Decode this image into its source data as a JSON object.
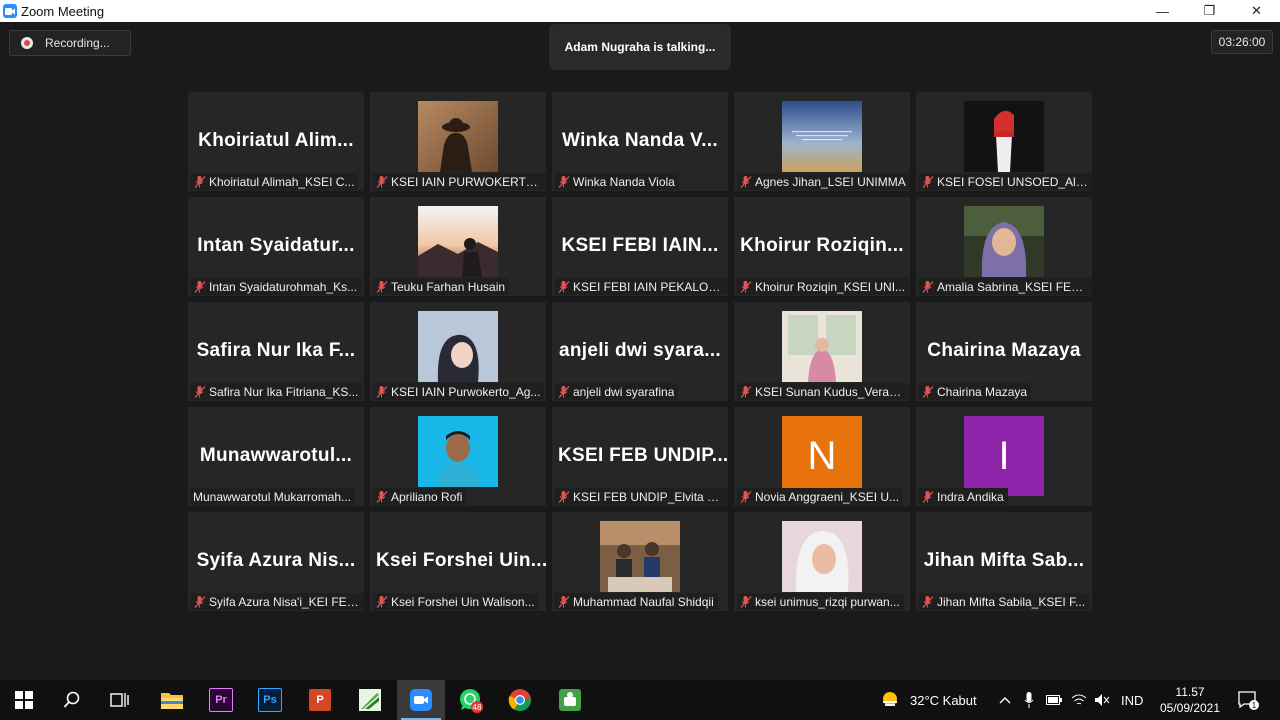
{
  "window": {
    "title": "Zoom Meeting",
    "minimize_glyph": "—",
    "restore_glyph": "❐",
    "close_glyph": "✕"
  },
  "meeting": {
    "recording_label": "Recording...",
    "talking_label": "Adam Nugraha is talking...",
    "timer": "03:26:00"
  },
  "participants": [
    {
      "display_text": "Khoiriatul Alim...",
      "name": "Khoiriatul Alimah_KSEI C...",
      "muted": true
    },
    {
      "display_text": "",
      "name": "KSEI IAIN PURWOKERTO_Silv...",
      "muted": true,
      "photo": "silhouette-hat"
    },
    {
      "display_text": "Winka Nanda V...",
      "name": "Winka Nanda Viola",
      "muted": true
    },
    {
      "display_text": "",
      "name": "Agnes Jihan_LSEI UNIMMA",
      "muted": true,
      "photo": "sky-quote"
    },
    {
      "display_text": "",
      "name": "KSEI FOSEI UNSOED_Alvi...",
      "muted": true,
      "photo": "fist-flag"
    },
    {
      "display_text": "Intan Syaidatur...",
      "name": "Intan Syaidaturohmah_Ks...",
      "muted": true
    },
    {
      "display_text": "",
      "name": "Teuku Farhan Husain",
      "muted": true,
      "photo": "mountain-sunset"
    },
    {
      "display_text": "KSEI FEBI IAIN...",
      "name": "KSEI FEBI IAIN PEKALONG...",
      "muted": true
    },
    {
      "display_text": "Khoirur Roziqin...",
      "name": "Khoirur Roziqin_KSEI UNI...",
      "muted": true
    },
    {
      "display_text": "",
      "name": "Amalia Sabrina_KSEI FEB ...",
      "muted": true,
      "photo": "hijab-smile"
    },
    {
      "display_text": "Safira Nur Ika F...",
      "name": "Safira Nur Ika Fitriana_KS...",
      "muted": true
    },
    {
      "display_text": "",
      "name": "KSEI IAIN Purwokerto_Ag...",
      "muted": true,
      "photo": "selfie-pastel"
    },
    {
      "display_text": "anjeli dwi syara...",
      "name": "anjeli dwi syarafina",
      "muted": true
    },
    {
      "display_text": "",
      "name": "KSEI Sunan Kudus_Veraw...",
      "muted": true,
      "photo": "window-seat"
    },
    {
      "display_text": "Chairina Mazaya",
      "name": "Chairina Mazaya",
      "muted": true
    },
    {
      "display_text": "Munawwarotul...",
      "name": "Munawwarotul Mukarromah...",
      "muted": false
    },
    {
      "display_text": "",
      "name": "Apriliano Rofi",
      "muted": true,
      "photo": "blue-portrait"
    },
    {
      "display_text": "KSEI FEB UNDIP...",
      "name": "KSEI FEB UNDIP_Elvita Nu...",
      "muted": true
    },
    {
      "display_text": "",
      "name": "Novia Anggraeni_KSEI U...",
      "muted": true,
      "letter": "N",
      "letter_color": "#e8730c"
    },
    {
      "display_text": "",
      "name": "Indra Andika",
      "muted": true,
      "letter": "I",
      "letter_color": "#8e24aa"
    },
    {
      "display_text": "Syifa Azura Nis...",
      "name": "Syifa Azura Nisa'i_KEI FEB...",
      "muted": true
    },
    {
      "display_text": "Ksei Forshei Uin...",
      "name": "Ksei Forshei Uin Walison...",
      "muted": true
    },
    {
      "display_text": "",
      "name": "Muhammad Naufal Shidqii",
      "muted": true,
      "photo": "group-cafe"
    },
    {
      "display_text": "",
      "name": "ksei unimus_rizqi purwan...",
      "muted": true,
      "photo": "hijab-pink"
    },
    {
      "display_text": "Jihan Mifta Sab...",
      "name": "Jihan Mifta Sabila_KSEI F...",
      "muted": true
    }
  ],
  "taskbar": {
    "apps": [
      {
        "name": "start-button",
        "glyph": ""
      },
      {
        "name": "search-button",
        "glyph": ""
      },
      {
        "name": "task-view-button",
        "glyph": ""
      },
      {
        "name": "file-explorer-app",
        "glyph": ""
      },
      {
        "name": "premiere-pro-app",
        "glyph": "Pr"
      },
      {
        "name": "photoshop-app",
        "glyph": "Ps"
      },
      {
        "name": "powerpoint-app",
        "glyph": "P"
      },
      {
        "name": "green-app",
        "glyph": ""
      },
      {
        "name": "zoom-app",
        "glyph": ""
      },
      {
        "name": "whatsapp-app",
        "glyph": "48"
      },
      {
        "name": "chrome-app",
        "glyph": ""
      },
      {
        "name": "android-app",
        "glyph": ""
      }
    ],
    "weather": "32°C  Kabut",
    "language": "IND",
    "time": "11.57",
    "date": "05/09/2021",
    "notification_count": "1",
    "accent": "#76b9ed"
  }
}
